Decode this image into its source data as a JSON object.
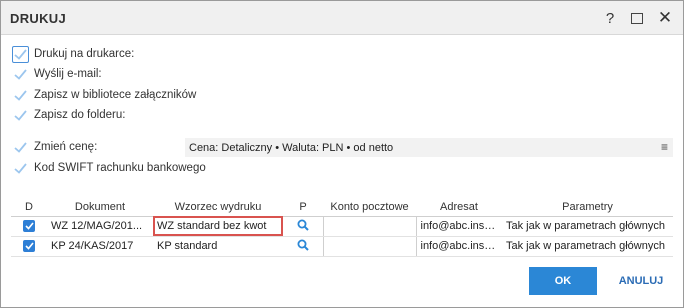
{
  "window": {
    "title": "DRUKUJ"
  },
  "titlebar": {
    "help": "?",
    "close": "✕"
  },
  "options": [
    {
      "label": "Drukuj na drukarce:",
      "checked": true
    },
    {
      "label": "Wyślij e-mail:",
      "checked": true
    },
    {
      "label": "Zapisz w bibliotece załączników",
      "checked": true
    },
    {
      "label": "Zapisz do folderu:",
      "checked": true
    }
  ],
  "price_options": [
    {
      "label": "Zmień cenę:",
      "checked": true
    },
    {
      "label": "Kod SWIFT rachunku bankowego",
      "checked": true
    }
  ],
  "cena_value": "Cena: Detaliczny • Waluta: PLN • od netto",
  "cena_menu_glyph": "≡",
  "table": {
    "headers": [
      "D",
      "Dokument",
      "Wzorzec wydruku",
      "P",
      "Konto pocztowe",
      "Adresat",
      "Parametry"
    ],
    "rows": [
      {
        "checked": true,
        "dokument": "WZ 12/MAG/201...",
        "wzorzec": "WZ standard bez kwot",
        "konto": "",
        "adresat": "info@abc.insert...",
        "parametry": "Tak jak w parametrach głównych"
      },
      {
        "checked": true,
        "dokument": "KP 24/KAS/2017",
        "wzorzec": "KP standard",
        "konto": "",
        "adresat": "info@abc.insert...",
        "parametry": "Tak jak w parametrach głównych"
      }
    ]
  },
  "buttons": {
    "ok": "OK",
    "cancel": "ANULUJ"
  },
  "colors": {
    "accent": "#2b87d6",
    "check_light": "#9cc6ee",
    "selection_border": "#d9534f"
  }
}
